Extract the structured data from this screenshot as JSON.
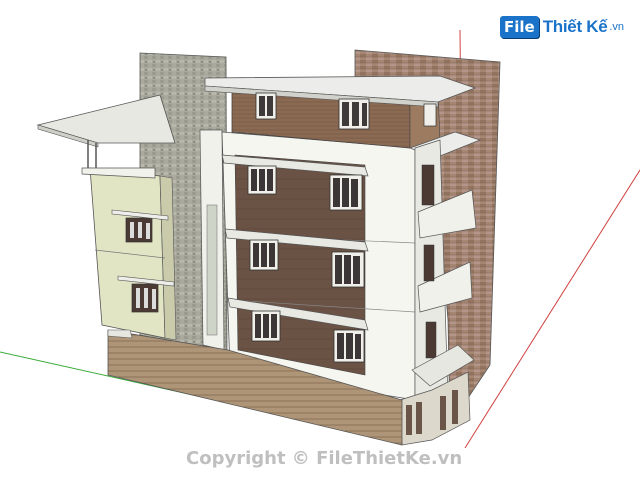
{
  "logo": {
    "badge": "File",
    "text": "Thiết Kế",
    "suffix": ".vn"
  },
  "watermark": {
    "text": "Copyright © FileThietKe.vn"
  },
  "colors": {
    "facade_white": "#f6f6f1",
    "facade_cream": "#e4e6c6",
    "brown_panel": "#6e5546",
    "wood_panel": "#8a6a4f",
    "stone_grey": "#a7a79d",
    "brick": "#9c7d69",
    "base_stripes": "#a88f72",
    "axis_red": "#d04040",
    "axis_green": "#3cab3c"
  }
}
